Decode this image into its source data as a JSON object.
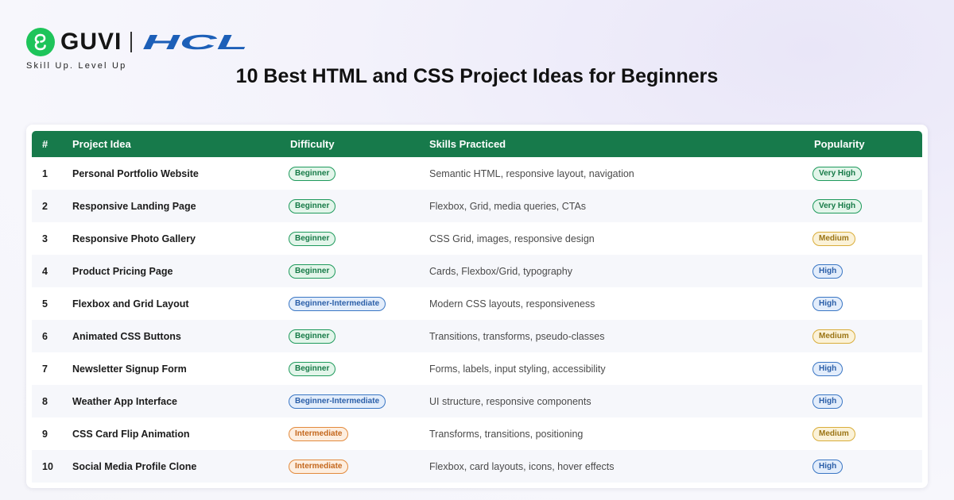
{
  "brand": {
    "guvi_name": "GUVI",
    "partner_name": "HCL",
    "tagline": "Skill Up. Level Up",
    "guvi_color": "#1ec45a",
    "hcl_color": "#1c5fb8"
  },
  "title": "10 Best HTML and CSS Project Ideas for Beginners",
  "colors": {
    "header_bg": "#177a4b",
    "green_badge": "#1f9a5c",
    "blue_badge": "#3a76c4",
    "orange_badge": "#e38a3c",
    "yellow_badge": "#d9ad3a"
  },
  "table": {
    "headers": {
      "num": "#",
      "idea": "Project Idea",
      "difficulty": "Difficulty",
      "skills": "Skills Practiced",
      "popularity": "Popularity"
    },
    "rows": [
      {
        "num": "1",
        "idea": "Personal Portfolio Website",
        "difficulty": "Beginner",
        "difficulty_color": "green",
        "skills": "Semantic HTML, responsive layout, navigation",
        "popularity": "Very High",
        "popularity_color": "green"
      },
      {
        "num": "2",
        "idea": "Responsive Landing Page",
        "difficulty": "Beginner",
        "difficulty_color": "green",
        "skills": "Flexbox, Grid, media queries, CTAs",
        "popularity": "Very High",
        "popularity_color": "green"
      },
      {
        "num": "3",
        "idea": "Responsive Photo Gallery",
        "difficulty": "Beginner",
        "difficulty_color": "green",
        "skills": "CSS Grid, images, responsive design",
        "popularity": "Medium",
        "popularity_color": "yellow"
      },
      {
        "num": "4",
        "idea": "Product Pricing Page",
        "difficulty": "Beginner",
        "difficulty_color": "green",
        "skills": "Cards, Flexbox/Grid, typography",
        "popularity": "High",
        "popularity_color": "blue"
      },
      {
        "num": "5",
        "idea": "Flexbox and Grid Layout",
        "difficulty": "Beginner-Intermediate",
        "difficulty_color": "blue",
        "skills": "Modern CSS layouts, responsiveness",
        "popularity": "High",
        "popularity_color": "blue"
      },
      {
        "num": "6",
        "idea": "Animated CSS Buttons",
        "difficulty": "Beginner",
        "difficulty_color": "green",
        "skills": "Transitions, transforms, pseudo-classes",
        "popularity": "Medium",
        "popularity_color": "yellow"
      },
      {
        "num": "7",
        "idea": "Newsletter Signup Form",
        "difficulty": "Beginner",
        "difficulty_color": "green",
        "skills": "Forms, labels, input styling, accessibility",
        "popularity": "High",
        "popularity_color": "blue"
      },
      {
        "num": "8",
        "idea": "Weather App Interface",
        "difficulty": "Beginner-Intermediate",
        "difficulty_color": "blue",
        "skills": "UI structure, responsive components",
        "popularity": "High",
        "popularity_color": "blue"
      },
      {
        "num": "9",
        "idea": "CSS Card Flip Animation",
        "difficulty": "Intermediate",
        "difficulty_color": "orange",
        "skills": "Transforms, transitions, positioning",
        "popularity": "Medium",
        "popularity_color": "yellow"
      },
      {
        "num": "10",
        "idea": "Social Media Profile Clone",
        "difficulty": "Intermediate",
        "difficulty_color": "orange",
        "skills": "Flexbox, card layouts, icons, hover effects",
        "popularity": "High",
        "popularity_color": "blue"
      }
    ]
  }
}
